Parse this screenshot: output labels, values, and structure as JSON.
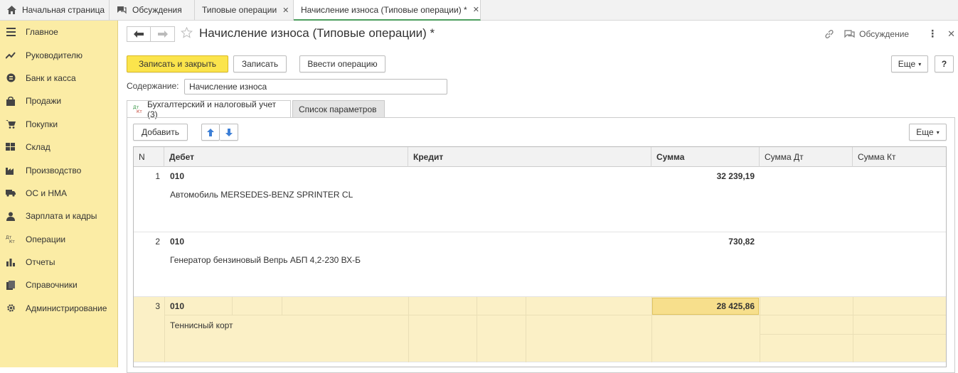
{
  "tabs": [
    {
      "label": "Начальная страница",
      "icon": "home-icon"
    },
    {
      "label": "Обсуждения",
      "icon": "chat-icon"
    },
    {
      "label": "Типовые операции",
      "icon": "close-icon"
    },
    {
      "label": "Начисление износа (Типовые операции) *",
      "icon": "close-icon"
    }
  ],
  "sidebar": {
    "items": [
      {
        "label": "Главное",
        "icon": "menu-icon"
      },
      {
        "label": "Руководителю",
        "icon": "trend-icon"
      },
      {
        "label": "Банк и касса",
        "icon": "coin-icon"
      },
      {
        "label": "Продажи",
        "icon": "bag-icon"
      },
      {
        "label": "Покупки",
        "icon": "cart-icon"
      },
      {
        "label": "Склад",
        "icon": "warehouse-icon"
      },
      {
        "label": "Производство",
        "icon": "factory-icon"
      },
      {
        "label": "ОС и НМА",
        "icon": "truck-icon"
      },
      {
        "label": "Зарплата и кадры",
        "icon": "person-icon"
      },
      {
        "label": "Операции",
        "icon": "dt-kt-icon"
      },
      {
        "label": "Отчеты",
        "icon": "bar-chart-icon"
      },
      {
        "label": "Справочники",
        "icon": "books-icon"
      },
      {
        "label": "Администрирование",
        "icon": "gear-icon"
      }
    ]
  },
  "header": {
    "title": "Начисление износа (Типовые операции) *",
    "discussion_label": "Обсуждение"
  },
  "toolbar": {
    "save_close": "Записать и закрыть",
    "save": "Записать",
    "enter_operation": "Ввести операцию",
    "more": "Еще",
    "help": "?"
  },
  "form": {
    "content_label": "Содержание:",
    "content_value": "Начисление износа"
  },
  "form_tabs": {
    "accounting": "Бухгалтерский и налоговый учет (3)",
    "params": "Список параметров"
  },
  "table_toolbar": {
    "add": "Добавить",
    "more": "Еще"
  },
  "table": {
    "columns": [
      "N",
      "Дебет",
      "Кредит",
      "Сумма",
      "Сумма Дт",
      "Сумма Кт"
    ],
    "rows": [
      {
        "n": "1",
        "debit": "010",
        "debit_sub": "Автомобиль MERSEDES-BENZ SPRINTER CL",
        "sum": "32 239,19"
      },
      {
        "n": "2",
        "debit": "010",
        "debit_sub": "Генератор бензиновый Вепрь АБП 4,2-230 ВХ-Б",
        "sum": "730,82"
      },
      {
        "n": "3",
        "debit": "010",
        "debit_sub": "Теннисный корт",
        "sum": "28 425,86"
      }
    ]
  }
}
